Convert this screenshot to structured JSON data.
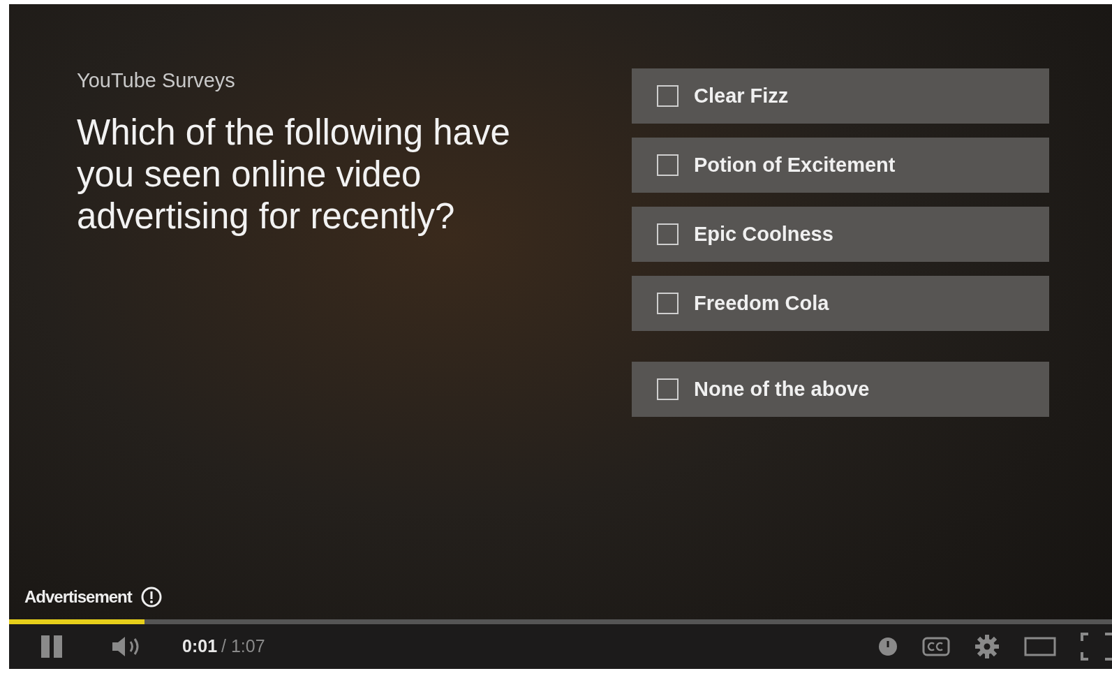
{
  "survey": {
    "brand": "YouTube Surveys",
    "question": "Which of the following have you seen online video advertising for recently?",
    "options": [
      {
        "label": "Clear Fizz",
        "kind": "brand",
        "checked": false
      },
      {
        "label": "Potion of Excitement",
        "kind": "brand",
        "checked": false
      },
      {
        "label": "Epic Coolness",
        "kind": "brand",
        "checked": false
      },
      {
        "label": "Freedom Cola",
        "kind": "brand",
        "checked": false
      },
      {
        "label": "None of the above",
        "kind": "none",
        "checked": false
      }
    ]
  },
  "ad_label": "Advertisement",
  "player": {
    "progress": {
      "level": 0.123
    },
    "playing": true,
    "current_time": "0:01",
    "duration": "/ 1:07"
  }
}
